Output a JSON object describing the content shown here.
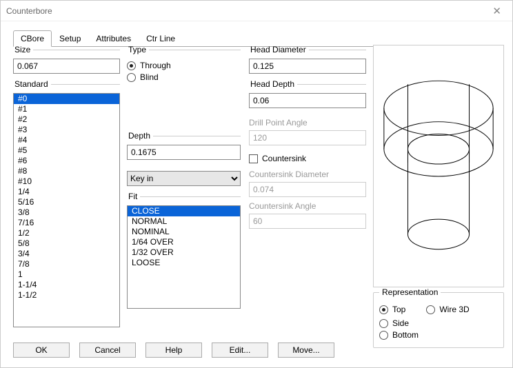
{
  "window": {
    "title": "Counterbore"
  },
  "tabs": [
    {
      "label": "CBore",
      "active": true
    },
    {
      "label": "Setup"
    },
    {
      "label": "Attributes"
    },
    {
      "label": "Ctr Line"
    }
  ],
  "size": {
    "legend": "Size",
    "value": "0.067"
  },
  "standard": {
    "legend": "Standard",
    "selected": "#0",
    "items": [
      "#0",
      "#1",
      "#2",
      "#3",
      "#4",
      "#5",
      "#6",
      "#8",
      "#10",
      "1/4",
      "5/16",
      "3/8",
      "7/16",
      "1/2",
      "5/8",
      "3/4",
      "7/8",
      "1",
      "1-1/4",
      "1-1/2"
    ]
  },
  "type": {
    "legend": "Type",
    "through": "Through",
    "blind": "Blind",
    "selected": "through"
  },
  "depth": {
    "legend": "Depth",
    "value": "0.1675"
  },
  "keyin": {
    "selected": "Key in"
  },
  "fit": {
    "legend": "Fit",
    "selected": "CLOSE",
    "items": [
      "CLOSE",
      "NORMAL",
      "NOMINAL",
      "1/64 OVER",
      "1/32 OVER",
      "LOOSE"
    ]
  },
  "head_diameter": {
    "legend": "Head Diameter",
    "value": "0.125"
  },
  "head_depth": {
    "legend": "Head Depth",
    "value": "0.06"
  },
  "drill_point_angle": {
    "label": "Drill Point Angle",
    "value": "120"
  },
  "countersink": {
    "label": "Countersink",
    "checked": false
  },
  "countersink_diameter": {
    "label": "Countersink Diameter",
    "value": "0.074"
  },
  "countersink_angle": {
    "label": "Countersink Angle",
    "value": "60"
  },
  "representation": {
    "legend": "Representation",
    "top": "Top",
    "wire3d": "Wire 3D",
    "side": "Side",
    "bottom": "Bottom",
    "selected": "top"
  },
  "buttons": {
    "ok": "OK",
    "cancel": "Cancel",
    "help": "Help",
    "edit": "Edit...",
    "move": "Move..."
  }
}
